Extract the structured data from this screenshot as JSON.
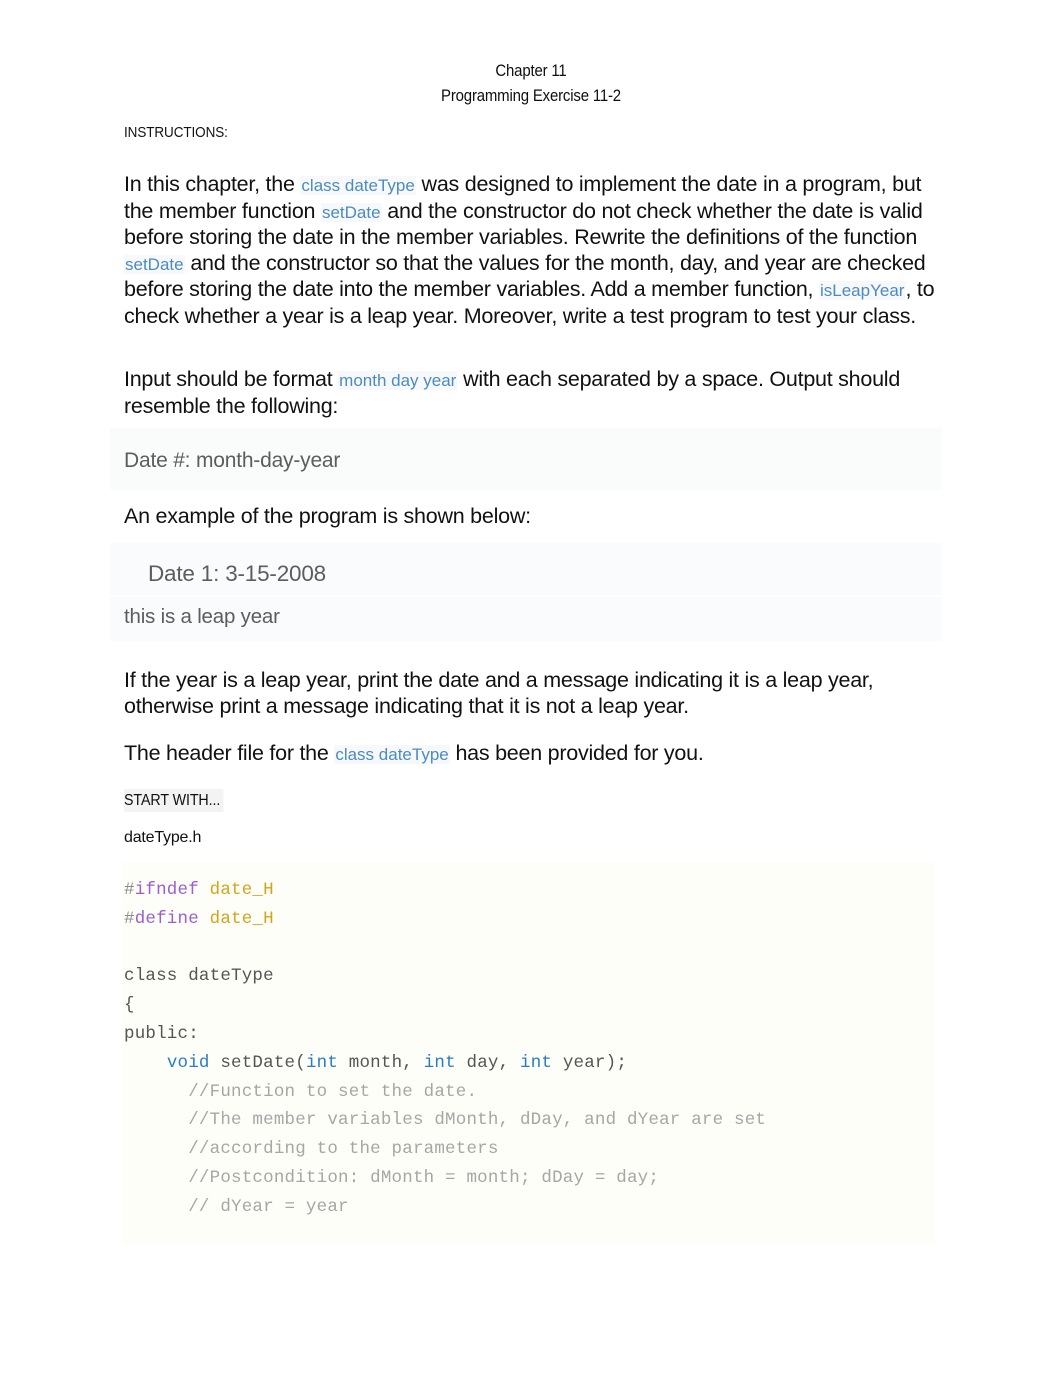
{
  "header": {
    "line1": "Chapter 11",
    "line2": "Programming Exercise 11-2"
  },
  "instructions_label": "INSTRUCTIONS:",
  "paragraphs": {
    "p1": {
      "s1": "In this chapter, the ",
      "c1": "class dateType",
      "s2": " was designed to implement the date in a program, but the member function ",
      "c2": "setDate",
      "s3": " and the constructor do not check whether the date is valid before storing the date in the member variables. Rewrite the definitions of the function ",
      "c3": "setDate",
      "s4": " and the constructor so that the values for the month, day, and year are checked before storing the date into the member variables. Add a member function, ",
      "c4": "isLeapYear",
      "s5": ", to check whether a year is a leap year. Moreover, write a test program to test your class."
    },
    "p2": {
      "s1": "Input should be format ",
      "c1": "month day year",
      "s2": " with each separated by a space. Output should resemble the following:"
    },
    "p3": "An example of the program is shown below:",
    "p4": "If the year is a leap year, print the date and a message indicating it is a leap year, otherwise print a message indicating that it is not a leap year.",
    "p5": {
      "s1": "The header file for the ",
      "c1": "class dateType",
      "s2": " has been provided for you."
    }
  },
  "output_format_sample": "Date #: month-day-year",
  "example_output": {
    "line1": "Date 1: 3-15-2008",
    "line2": "this is a leap year"
  },
  "start_with_label": "START WITH...",
  "code_filename": "dateType.h",
  "code_lines": [
    {
      "id": "l1",
      "tokens": [
        {
          "t": "#",
          "c": "tok-pp"
        },
        {
          "t": "ifndef",
          "c": "tok-dir"
        },
        {
          "t": " ",
          "c": "tok-plain"
        },
        {
          "t": "date_H",
          "c": "tok-macro"
        }
      ]
    },
    {
      "id": "l2",
      "tokens": [
        {
          "t": "#",
          "c": "tok-pp"
        },
        {
          "t": "define",
          "c": "tok-dir"
        },
        {
          "t": " ",
          "c": "tok-plain"
        },
        {
          "t": "date_H",
          "c": "tok-macro"
        }
      ]
    },
    {
      "id": "l3",
      "tokens": [
        {
          "t": " ",
          "c": "tok-plain"
        }
      ]
    },
    {
      "id": "l4",
      "tokens": [
        {
          "t": "class dateType",
          "c": "tok-plain"
        }
      ]
    },
    {
      "id": "l5",
      "tokens": [
        {
          "t": "{",
          "c": "tok-plain"
        }
      ]
    },
    {
      "id": "l6",
      "tokens": [
        {
          "t": "public:",
          "c": "tok-plain"
        }
      ]
    },
    {
      "id": "l7",
      "tokens": [
        {
          "t": "    ",
          "c": "tok-plain"
        },
        {
          "t": "void",
          "c": "tok-kw"
        },
        {
          "t": " setDate(",
          "c": "tok-plain"
        },
        {
          "t": "int",
          "c": "tok-kw"
        },
        {
          "t": " month, ",
          "c": "tok-plain"
        },
        {
          "t": "int",
          "c": "tok-kw"
        },
        {
          "t": " day, ",
          "c": "tok-plain"
        },
        {
          "t": "int",
          "c": "tok-kw"
        },
        {
          "t": " year);",
          "c": "tok-plain"
        }
      ]
    },
    {
      "id": "l8",
      "tokens": [
        {
          "t": "      //Function to set the date.",
          "c": "tok-cmt"
        }
      ]
    },
    {
      "id": "l9",
      "tokens": [
        {
          "t": "      //The member variables dMonth, dDay, and dYear are set",
          "c": "tok-cmt"
        }
      ]
    },
    {
      "id": "l10",
      "tokens": [
        {
          "t": "      //according to the parameters",
          "c": "tok-cmt"
        }
      ]
    },
    {
      "id": "l11",
      "tokens": [
        {
          "t": "      //Postcondition: dMonth = month; dDay = day;",
          "c": "tok-cmt"
        }
      ]
    },
    {
      "id": "l12",
      "tokens": [
        {
          "t": "      // dYear = year",
          "c": "tok-cmt"
        }
      ]
    }
  ],
  "colors": {
    "inline_code": "#4a8cc2",
    "keyword": "#2b7cc4",
    "directive": "#9a5fd0",
    "macro": "#d3a41c",
    "comment": "#a6a6a6",
    "code_bg": "#fefef9",
    "band_bg": "#fafbfb"
  }
}
